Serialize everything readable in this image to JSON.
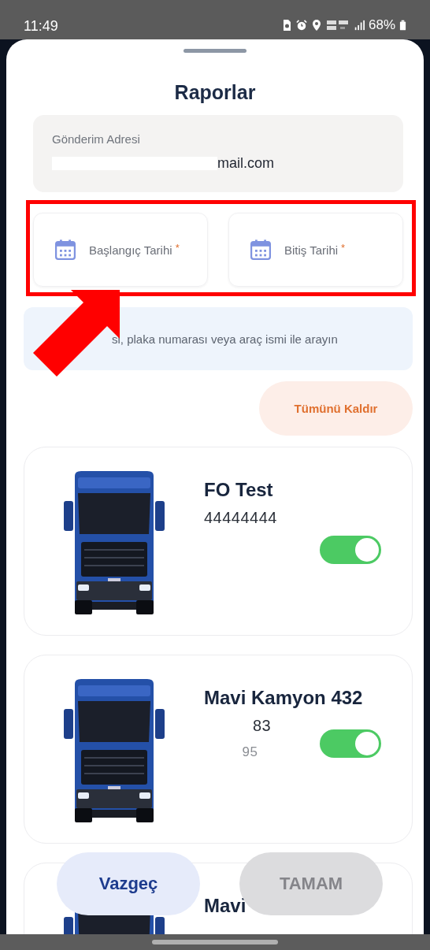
{
  "status_bar": {
    "time": "11:49",
    "battery": "68%"
  },
  "sheet": {
    "title": "Raporlar"
  },
  "email_field": {
    "label": "Gönderim Adresi",
    "value": "mail.com"
  },
  "date_fields": [
    {
      "label": "Başlangıç Tarihi",
      "required_mark": "*"
    },
    {
      "label": "Bitiş Tarihi",
      "required_mark": "*"
    }
  ],
  "search": {
    "placeholder": "si, plaka numarası veya araç ismi ile arayın"
  },
  "clear_all_button": {
    "label": "Tümünü Kaldır"
  },
  "vehicles": [
    {
      "name": "FO Test",
      "details": [
        "44444444"
      ],
      "on": true
    },
    {
      "name": "Mavi Kamyon 432",
      "details": [
        "83",
        "95"
      ],
      "on": true
    },
    {
      "name": "Mavi"
    }
  ],
  "actions": [
    {
      "label": "Vazgeç",
      "disabled": false
    },
    {
      "label": "TAMAM",
      "disabled": true
    }
  ]
}
